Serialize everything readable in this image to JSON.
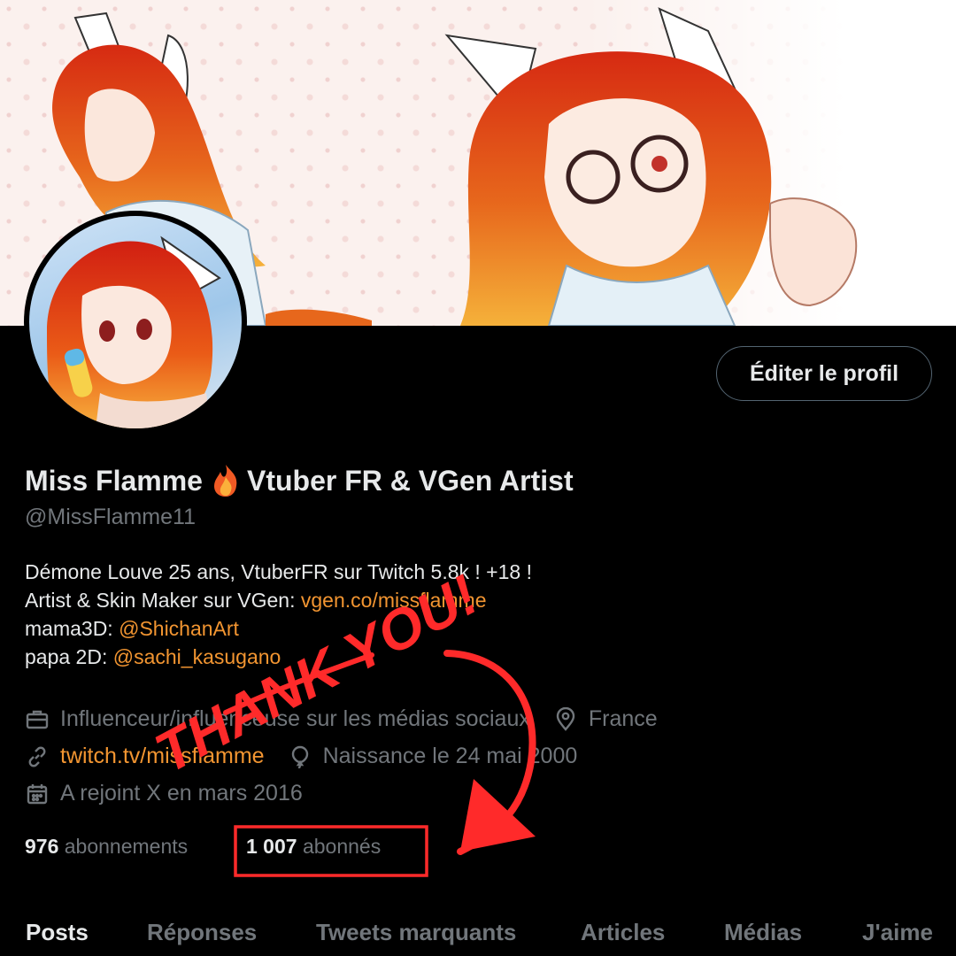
{
  "profile": {
    "display_name": "Miss Flamme",
    "display_name_suffix": "Vtuber FR & VGen Artist",
    "handle": "@MissFlamme11",
    "bio_lines": [
      "Démone Louve 25 ans, VtuberFR sur Twitch 5.8k ! +18 !",
      "Artist & Skin Maker sur VGen: ",
      "mama3D: ",
      "papa 2D: "
    ],
    "bio_links": {
      "vgen": "vgen.co/missflamme",
      "mama3d": "@ShichanArt",
      "papa2d": "@sachi_kasugano"
    },
    "category": "Influenceur/influenceuse sur les médias sociaux",
    "location": "France",
    "website": "twitch.tv/missflamme",
    "birthday": "Naissance le 24 mai 2000",
    "joined": "A rejoint X en mars 2016",
    "following_count": "976",
    "following_label": "abonnements",
    "followers_count": "1 007",
    "followers_label": "abonnés"
  },
  "edit_button_label": "Éditer le profil",
  "tabs": [
    "Posts",
    "Réponses",
    "Tweets marquants",
    "Articles",
    "Médias",
    "J'aime"
  ],
  "overlay": {
    "text": "THANK YOU!",
    "color": "#ff2a2a"
  },
  "icons": {
    "flame": "fire-emoji",
    "category": "briefcase-icon",
    "location": "location-pin-icon",
    "website": "link-icon",
    "birthday": "balloon-icon",
    "joined": "calendar-icon"
  },
  "colors": {
    "accent": "#f29531",
    "muted": "#71767b",
    "text": "#e7e9ea",
    "overlay": "#ff2a2a"
  }
}
